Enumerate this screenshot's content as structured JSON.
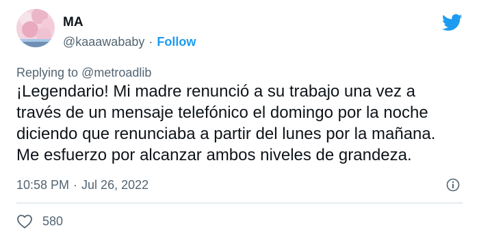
{
  "author": {
    "name": "MA",
    "handle": "@kaaawababy",
    "follow_label": "Follow"
  },
  "reply": {
    "prefix": "Replying to",
    "mention": "@metroadlib"
  },
  "tweet": {
    "lines": [
      "¡Legendario! Mi madre renunció a su trabajo una vez a",
      "través de un mensaje telefónico el domingo por la noche",
      "diciendo que renunciaba a partir del lunes por la mañana.",
      "Me esfuerzo por alcanzar ambos niveles de grandeza."
    ],
    "time": "10:58 PM",
    "date": "Jul 26, 2022",
    "likes": "580"
  },
  "colors": {
    "accent": "#1d9bf0",
    "secondary_text": "#536471",
    "divider": "#cfd9de"
  },
  "icons": {
    "brand": "twitter-bird-icon",
    "info": "info-icon",
    "like": "heart-icon"
  }
}
